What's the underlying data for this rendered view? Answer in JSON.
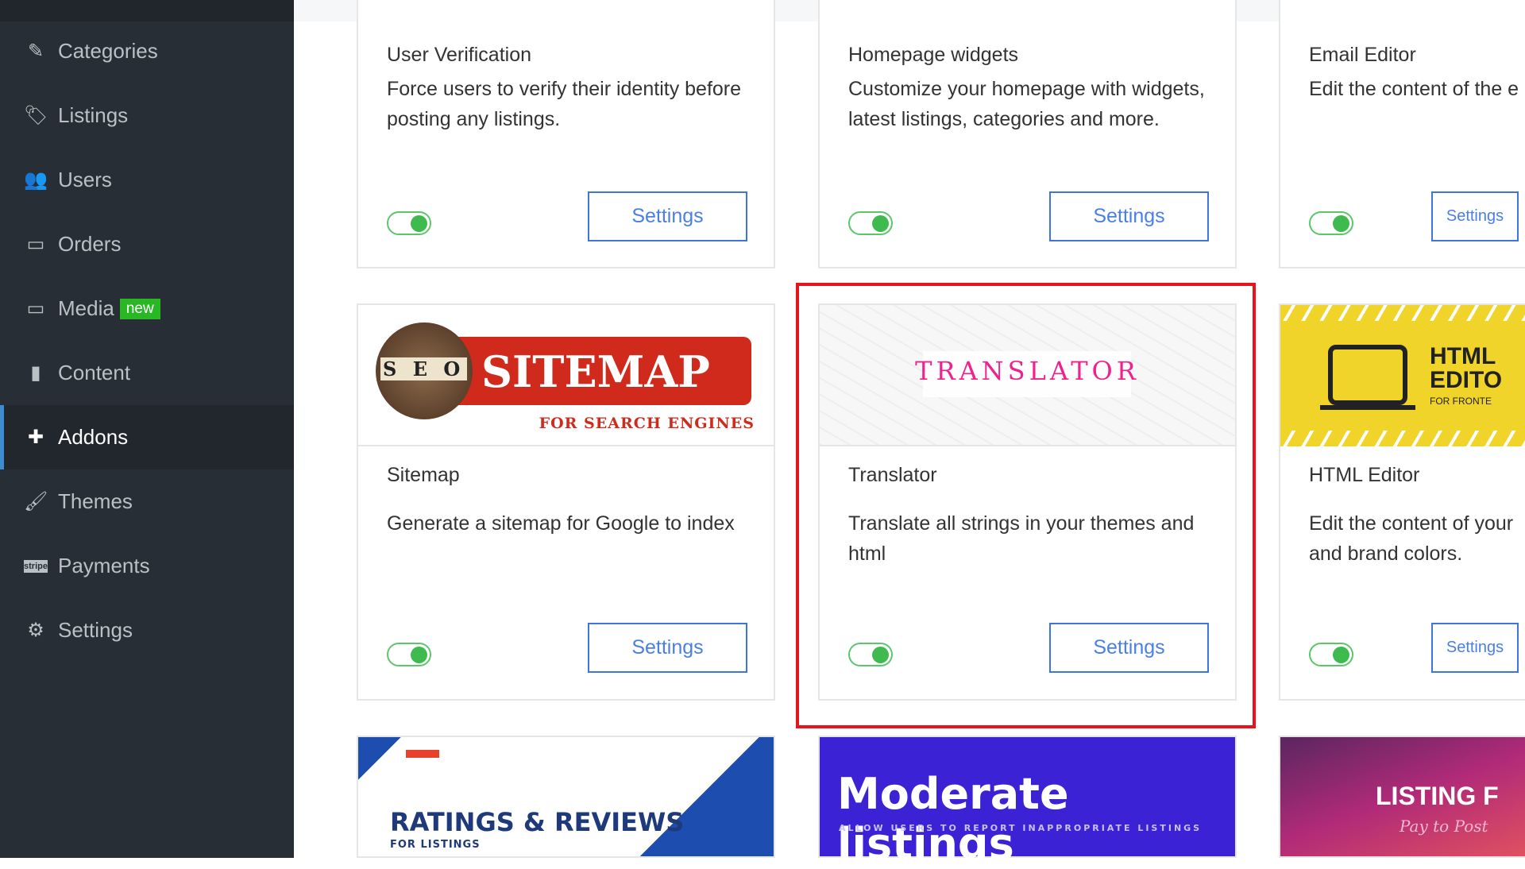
{
  "sidebar": {
    "items": [
      {
        "label": "Categories",
        "icon": "edit-icon",
        "glyph": "✎"
      },
      {
        "label": "Listings",
        "icon": "tags-icon",
        "glyph": "🏷"
      },
      {
        "label": "Users",
        "icon": "users-icon",
        "glyph": "👥"
      },
      {
        "label": "Orders",
        "icon": "inbox-icon",
        "glyph": "▭"
      },
      {
        "label": "Media",
        "icon": "inbox-icon",
        "glyph": "▭",
        "badge": "new"
      },
      {
        "label": "Content",
        "icon": "file-icon",
        "glyph": "▮"
      },
      {
        "label": "Addons",
        "icon": "puzzle-icon",
        "glyph": "✚",
        "active": true
      },
      {
        "label": "Themes",
        "icon": "brush-icon",
        "glyph": "🖌"
      },
      {
        "label": "Payments",
        "icon": "stripe-icon",
        "glyph": "stripe"
      },
      {
        "label": "Settings",
        "icon": "gears-icon",
        "glyph": "⚙"
      }
    ]
  },
  "addons": [
    {
      "title": "User Verification",
      "desc": "Force users to verify their identity before posting any listings.",
      "enabled": true,
      "button": "Settings"
    },
    {
      "title": "Homepage widgets",
      "desc": "Customize your homepage with widgets, latest listings, categories and more.",
      "enabled": true,
      "button": "Settings"
    },
    {
      "title": "Email Editor",
      "desc": "Edit the content of the e",
      "enabled": true,
      "button": "Settings"
    },
    {
      "title": "Sitemap",
      "desc": "Generate a sitemap for Google to index",
      "enabled": true,
      "button": "Settings",
      "banner": {
        "main": "SITEMAP",
        "sub": "FOR SEARCH ENGINES",
        "letters": "S E O"
      }
    },
    {
      "title": "Translator",
      "desc": "Translate all strings in your themes and html",
      "enabled": true,
      "button": "Settings",
      "banner": {
        "main": "TRANSLATOR"
      }
    },
    {
      "title": "HTML Editor",
      "desc": "Edit the content of your and brand colors.",
      "enabled": true,
      "button": "Settings",
      "banner": {
        "main": "HTML EDITO",
        "sub": "FOR FRONTE"
      }
    },
    {
      "banner": {
        "main": "RATINGS & REVIEWS",
        "sub": "FOR LISTINGS"
      }
    },
    {
      "banner": {
        "main": "Moderate listings",
        "sub": "ALLOW USERS TO REPORT INAPPROPRIATE LISTINGS"
      }
    },
    {
      "banner": {
        "main": "LISTING F",
        "sub": "Pay to Post"
      }
    }
  ],
  "colors": {
    "sidebar": "#272e35",
    "accent": "#3d74de",
    "toggle_on": "#3fba4e",
    "highlight": "#e8141c",
    "badge": "#29b824"
  }
}
